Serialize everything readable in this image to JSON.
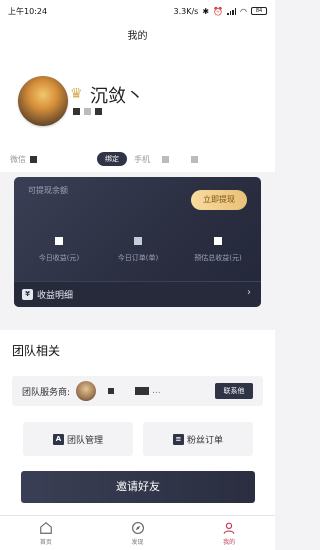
{
  "status": {
    "time": "上午10:24",
    "net_speed": "3.3K/s",
    "battery": "84"
  },
  "page": {
    "title": "我的"
  },
  "profile": {
    "nickname": "沉敛丶"
  },
  "account": {
    "wechat_label": "微信",
    "bind_label": "绑定",
    "phone_label": "手机"
  },
  "earnings": {
    "available_label": "可提现余额",
    "withdraw_label": "立即提现",
    "stats": [
      {
        "label": "今日收益(元)"
      },
      {
        "label": "今日订单(单)"
      },
      {
        "label": "预估总收益(元)"
      }
    ],
    "detail_label": "收益明细",
    "detail_icon_text": "¥"
  },
  "team": {
    "title": "团队相关",
    "service_label": "团队服务商:",
    "service_dots": "...",
    "contact_label": "联系他",
    "manage_label": "团队管理",
    "manage_icon_text": "A",
    "fans_label": "粉丝订单",
    "invite_label": "邀请好友"
  },
  "tabbar": {
    "items": [
      {
        "label": "首页",
        "icon": "home-icon"
      },
      {
        "label": "发现",
        "icon": "compass-icon"
      },
      {
        "label": "我的",
        "icon": "person-icon",
        "active": true
      }
    ]
  },
  "colors": {
    "accent": "#c03a52",
    "card": "#2f3447",
    "gold": "#e9c078"
  }
}
